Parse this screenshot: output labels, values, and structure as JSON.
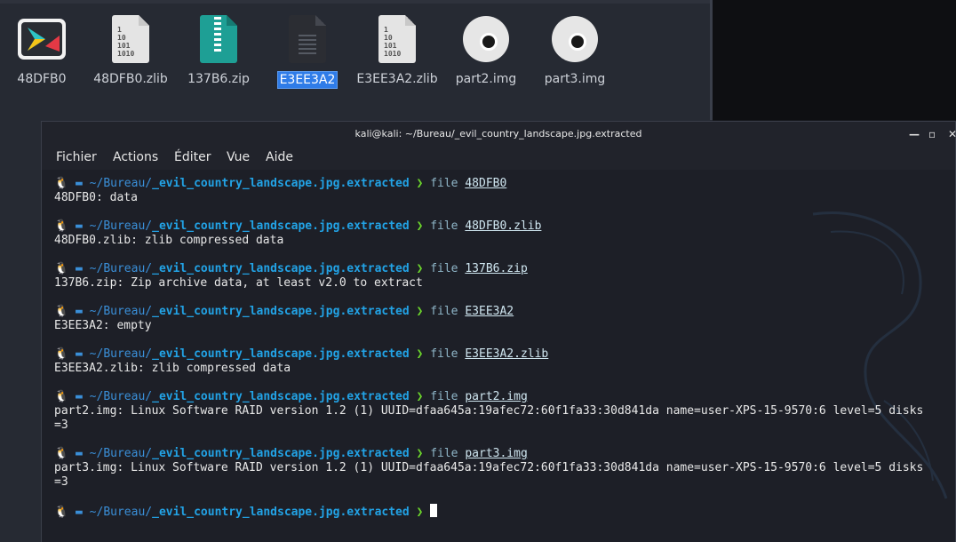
{
  "desktop": {
    "files": [
      {
        "name": "48DFB0",
        "icon": "app-launcher-icon",
        "selected": false
      },
      {
        "name": "48DFB0.zlib",
        "icon": "binary-file-icon",
        "selected": false
      },
      {
        "name": "137B6.zip",
        "icon": "zip-archive-icon",
        "selected": false
      },
      {
        "name": "E3EE3A2",
        "icon": "text-file-icon",
        "selected": true
      },
      {
        "name": "E3EE3A2.zlib",
        "icon": "binary-file-icon",
        "selected": false
      },
      {
        "name": "part2.img",
        "icon": "disc-image-icon",
        "selected": false
      },
      {
        "name": "part3.img",
        "icon": "disc-image-icon",
        "selected": false
      }
    ],
    "binary_glyph": "1\n10\n101\n1010"
  },
  "terminal": {
    "title": "kali@kali: ~/Bureau/_evil_country_landscape.jpg.extracted",
    "window_buttons": {
      "minimize": "—",
      "maximize": "▫",
      "close": "✕"
    },
    "menu": [
      "Fichier",
      "Actions",
      "Éditer",
      "Vue",
      "Aide"
    ],
    "prompt": {
      "icon": "🐧",
      "folder_icon": "▬",
      "path_prefix": "~/Bureau/",
      "path_dir": "_evil_country_landscape.jpg.extracted",
      "arrow": "❯",
      "command": "file"
    },
    "entries": [
      {
        "arg": "48DFB0",
        "output": [
          "48DFB0: data"
        ]
      },
      {
        "arg": "48DFB0.zlib",
        "output": [
          "48DFB0.zlib: zlib compressed data"
        ]
      },
      {
        "arg": "137B6.zip",
        "output": [
          "137B6.zip: Zip archive data, at least v2.0 to extract"
        ]
      },
      {
        "arg": "E3EE3A2",
        "output": [
          "E3EE3A2: empty"
        ]
      },
      {
        "arg": "E3EE3A2.zlib",
        "output": [
          "E3EE3A2.zlib: zlib compressed data"
        ]
      },
      {
        "arg": "part2.img",
        "output": [
          "part2.img: Linux Software RAID version 1.2 (1) UUID=dfaa645a:19afec72:60f1fa33:30d841da name=user-XPS-15-9570:6 level=5 disks",
          "=3"
        ]
      },
      {
        "arg": "part3.img",
        "output": [
          "part3.img: Linux Software RAID version 1.2 (1) UUID=dfaa645a:19afec72:60f1fa33:30d841da name=user-XPS-15-9570:6 level=5 disks",
          "=3"
        ]
      }
    ]
  },
  "colors": {
    "path": "#22a3e6",
    "arrow": "#6cd62c",
    "selection": "#2f7ce8"
  }
}
